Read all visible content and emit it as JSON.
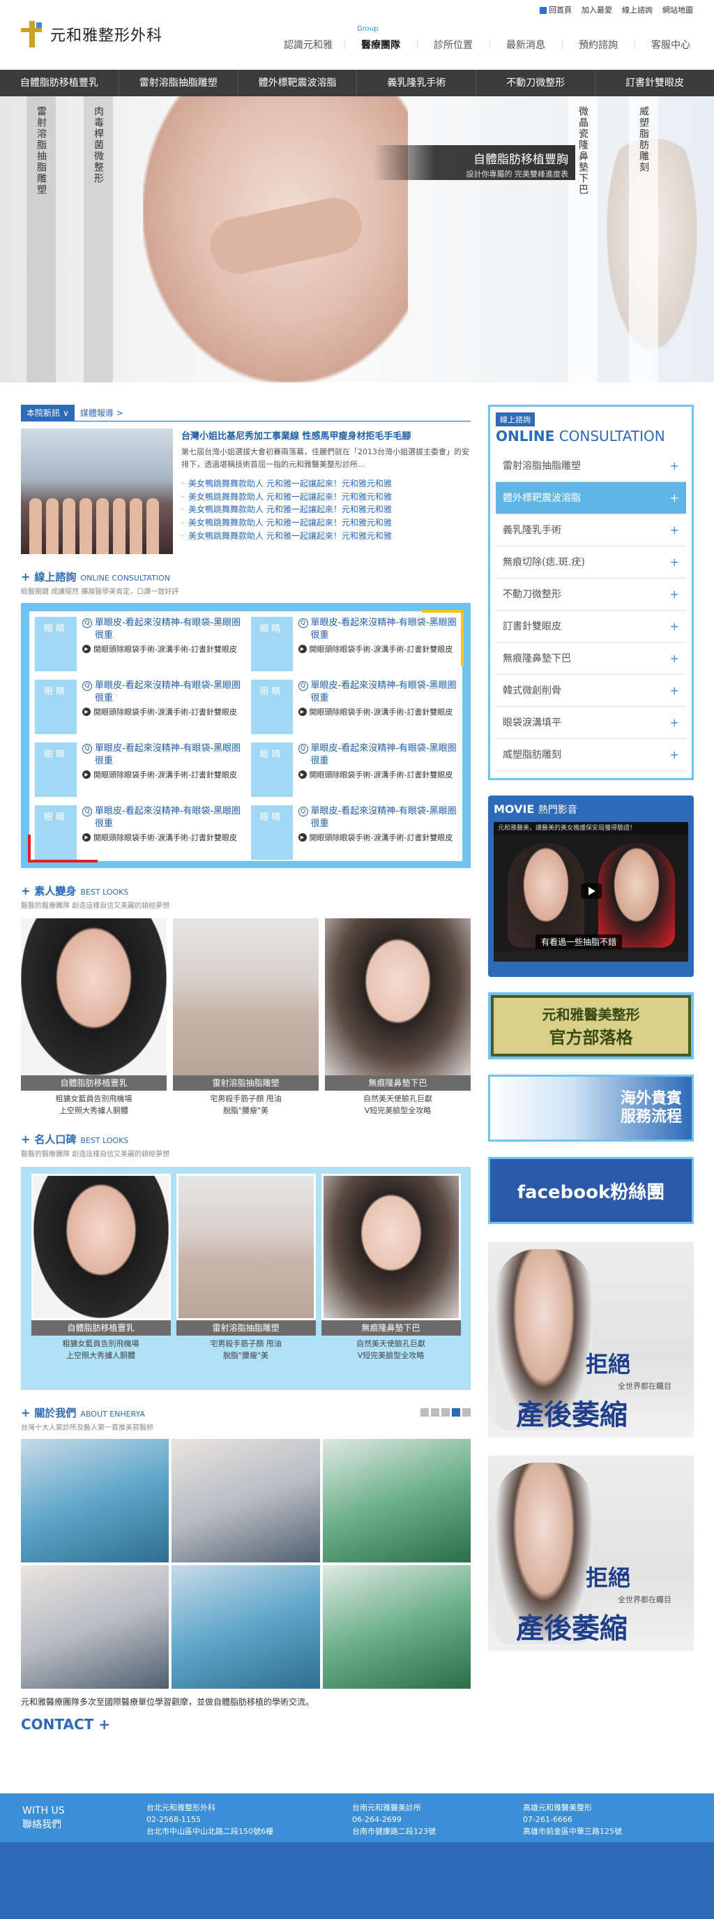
{
  "logo": {
    "text": "元和雅整形外科"
  },
  "util": [
    "回首頁",
    "加入最愛",
    "線上諮詢",
    "網站地圖"
  ],
  "nav": {
    "items": [
      "認識元和雅",
      "醫療團隊",
      "診所位置",
      "最新消息",
      "預約諮詢",
      "客服中心"
    ],
    "active_sub": "Group"
  },
  "categories": [
    "自體脂肪移植豐乳",
    "雷射溶脂抽脂雕塑",
    "體外標靶震波溶脂",
    "義乳隆乳手術",
    "不動刀微整形",
    "訂書針雙眼皮"
  ],
  "hero": {
    "strips": [
      "雷射溶脂抽脂雕塑",
      "肉毒桿菌微整形",
      "微晶瓷隆鼻墊下巴",
      "威塑脂肪雕刻"
    ],
    "caption_title": "自體脂肪移植豐胸",
    "caption_sub": "設計你專屬的 完美雙峰進度表"
  },
  "news": {
    "tab_active": "本院新訊",
    "tab_other": "媒體報導 >",
    "title": "台灣小姐比基尼秀加工事業線 性感馬甲瘦身材拒毛手毛腳",
    "desc": "第七屆台灣小姐選拔大會初賽兩落幕，佳麗們就在「2013台灣小姐選拔主委會」的安排下，透過堪稱技術首屈一指的元和雅醫美整形診所...",
    "list": [
      "美女鴨跳舞舞款助人 元和雅一起讓起來！元和雅元和雅",
      "美女鴨跳舞舞款助人 元和雅一起讓起來！元和雅元和雅",
      "美女鴨跳舞舞款助人 元和雅一起讓起來！元和雅元和雅",
      "美女鴨跳舞舞款助人 元和雅一起讓起來！元和雅元和雅",
      "美女鴨跳舞舞款助人 元和雅一起讓起來！元和雅元和雅"
    ]
  },
  "consult": {
    "zh": "線上諮詢",
    "en": "ONLINE CONSULTATION",
    "sub": "給醫關鍵 成讓擺然 擴展醫學美肯定，口讚一致好評",
    "items": [
      {
        "thumb": "眼睛",
        "q": "單眼皮-看起來沒精神-有眼袋-黑眼圈很重",
        "a": "開眼頭除眼袋手術-淚溝手術-訂書針雙眼皮"
      },
      {
        "thumb": "眼睛",
        "q": "單眼皮-看起來沒精神-有眼袋-黑眼圈很重",
        "a": "開眼頭除眼袋手術-淚溝手術-訂書針雙眼皮"
      },
      {
        "thumb": "眼睛",
        "q": "單眼皮-看起來沒精神-有眼袋-黑眼圈很重",
        "a": "開眼頭除眼袋手術-淚溝手術-訂書針雙眼皮"
      },
      {
        "thumb": "眼睛",
        "q": "單眼皮-看起來沒精神-有眼袋-黑眼圈很重",
        "a": "開眼頭除眼袋手術-淚溝手術-訂書針雙眼皮"
      },
      {
        "thumb": "眼睛",
        "q": "單眼皮-看起來沒精神-有眼袋-黑眼圈很重",
        "a": "開眼頭除眼袋手術-淚溝手術-訂書針雙眼皮"
      },
      {
        "thumb": "眼睛",
        "q": "單眼皮-看起來沒精神-有眼袋-黑眼圈很重",
        "a": "開眼頭除眼袋手術-淚溝手術-訂書針雙眼皮"
      },
      {
        "thumb": "眼睛",
        "q": "單眼皮-看起來沒精神-有眼袋-黑眼圈很重",
        "a": "開眼頭除眼袋手術-淚溝手術-訂書針雙眼皮"
      },
      {
        "thumb": "眼睛",
        "q": "單眼皮-看起來沒精神-有眼袋-黑眼圈很重",
        "a": "開眼頭除眼袋手術-淚溝手術-訂書針雙眼皮"
      }
    ]
  },
  "makeover": {
    "zh": "素人變身",
    "en": "BEST LOOKS",
    "sub": "醫醫的醫療團隊 創造這樣自信又美麗的銷經夢想",
    "cards": [
      {
        "label": "自體脂肪移植豐乳",
        "desc1": "粗獷女藍員告別飛機場",
        "desc2": "上空照大秀擄人胴體"
      },
      {
        "label": "雷射溶脂抽脂雕塑",
        "desc1": "宅男殺手筋子顏 甩油",
        "desc2": "脫脂\"腰瘦\"美"
      },
      {
        "label": "無痕隆鼻墊下巴",
        "desc1": "自然美天使臉孔巨獻",
        "desc2": "V短完美臉型全攻略"
      }
    ]
  },
  "celebs": {
    "zh": "名人口碑",
    "en": "BEST LOOKS",
    "sub": "醫醫的醫療團隊 創造這樣自信又美麗的銷經夢想",
    "cards": [
      {
        "label": "自體脂肪移植豐乳",
        "desc1": "粗獷女藍員告別飛機場",
        "desc2": "上空照大秀擄人胴體"
      },
      {
        "label": "雷射溶脂抽脂雕塑",
        "desc1": "宅男殺手筋子顏 甩油",
        "desc2": "脫脂\"腰瘦\"美"
      },
      {
        "label": "無痕隆鼻墊下巴",
        "desc1": "自然美天使臉孔巨獻",
        "desc2": "V短完美臉型全攻略"
      }
    ]
  },
  "about": {
    "zh": "關於我們",
    "en": "ABOUT ENHERYA",
    "sub": "台灣十大人氣診所及藝人第一首推美容醫師",
    "caption": "元和雅醫療團隊多次至國際醫療單位學習觀摩，並做自體脂肪移植的學術交流。",
    "contact": "CONTACT +"
  },
  "right": {
    "badge": "線上諮詢",
    "title_en": "ONLINE",
    "title_en2": "CONSULTATION",
    "items": [
      "雷射溶脂抽脂雕塑",
      "體外標靶震波溶脂",
      "義乳隆乳手術",
      "無痕切除(痣.斑.疣)",
      "不動刀微整形",
      "訂書針雙眼皮",
      "無痕隆鼻墊下巴",
      "韓式微創削骨",
      "眼袋淚溝填平",
      "威塑脂肪雕刻"
    ],
    "active_index": 1,
    "movie_title": "MOVIE",
    "movie_sub": "熱門影音",
    "movie_topbar": "元和雅醫美，講醫美的美女機護保安局獲得驗證！",
    "movie_caption": "有看過一些抽脂不錯",
    "blog_l1": "元和雅醫美整形",
    "blog_l2": "官方部落格",
    "intl_l1": "海外貴賓",
    "intl_l2": "服務流程",
    "fb": "facebook粉絲團",
    "ad_t1": "拒絕",
    "ad_t2": "全世界都在矚目",
    "ad_t3": "產後萎縮"
  },
  "footer": {
    "with1": "WITH US",
    "with2": "聯絡我們",
    "branches": [
      {
        "name": "台北元和雅整形外科",
        "phone": "02-2568-1155",
        "addr": "台北市中山區中山北路二段150號6樓"
      },
      {
        "name": "台南元和雅醫美診所",
        "phone": "06-264-2699",
        "addr": "台南市健康路二段123號"
      },
      {
        "name": "高雄元和雅醫美整形",
        "phone": "07-261-6666",
        "addr": "高雄市前金區中華三路125號"
      }
    ]
  }
}
